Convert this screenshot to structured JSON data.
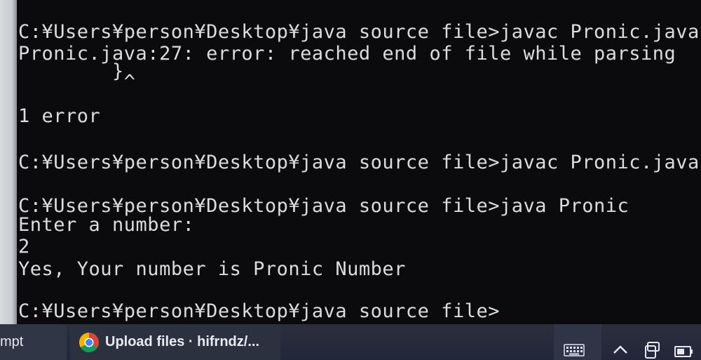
{
  "console": {
    "lines": [
      "C:¥Users¥person¥Desktop¥java source file>javac Pronic.java",
      "Pronic.java:27: error: reached end of file while parsing",
      "        }",
      "         ^",
      "1 error",
      "C:¥Users¥person¥Desktop¥java source file>javac Pronic.java",
      "C:¥Users¥person¥Desktop¥java source file>java Pronic",
      "Enter a number:",
      "2",
      "Yes, Your number is Pronic Number",
      "C:¥Users¥person¥Desktop¥java source file>"
    ]
  },
  "taskbar": {
    "prompt_label": "mpt",
    "chrome_label": "Upload files · hifrndz/...",
    "icons": {
      "browser": "chrome-icon",
      "keyboard": "keyboard-icon",
      "chevron": "chevron-up-icon",
      "device": "device-icon",
      "battery": "battery-icon"
    }
  },
  "colors": {
    "console_bg": "#0b0b0d",
    "console_text": "#dcdcdc",
    "taskbar_bg": "#262b3b"
  }
}
